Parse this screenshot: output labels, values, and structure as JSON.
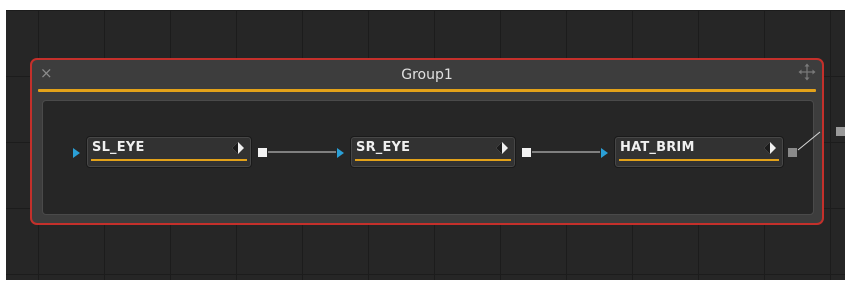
{
  "group": {
    "title": "Group1",
    "close_glyph": "×",
    "move_icon": "move-arrows-icon"
  },
  "nodes": [
    {
      "label": "SL_EYE",
      "icon": "diamond-view-icon"
    },
    {
      "label": "SR_EYE",
      "icon": "diamond-view-icon"
    },
    {
      "label": "HAT_BRIM",
      "icon": "diamond-view-icon"
    }
  ],
  "colors": {
    "canvas_bg": "#262626",
    "group_border": "#c4302b",
    "accent_bar": "#e3a21a",
    "input_arrow": "#2a9fd6",
    "output_port": "#f2f2f2"
  }
}
